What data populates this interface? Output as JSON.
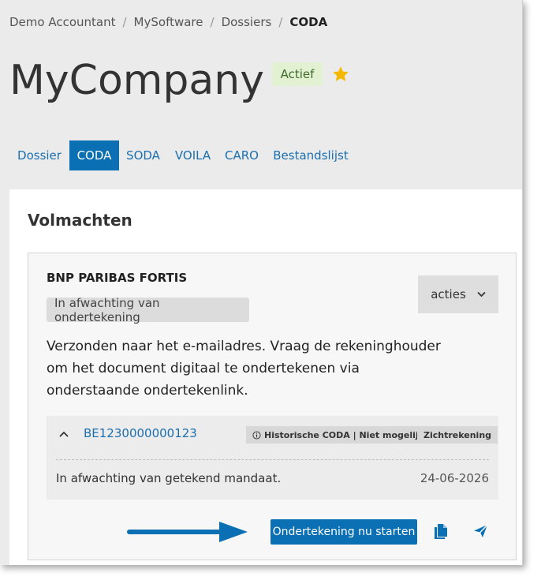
{
  "breadcrumb": {
    "items": [
      "Demo Accountant",
      "MySoftware",
      "Dossiers"
    ],
    "current": "CODA"
  },
  "header": {
    "title": "MyCompany",
    "status": "Actief"
  },
  "tabs": [
    {
      "label": "Dossier"
    },
    {
      "label": "CODA",
      "active": true
    },
    {
      "label": "SODA"
    },
    {
      "label": "VOILA"
    },
    {
      "label": "CARO"
    },
    {
      "label": "Bestandslijst"
    }
  ],
  "section": {
    "title": "Volmachten"
  },
  "card": {
    "bank": "BNP PARIBAS FORTIS",
    "status": "In afwachting van ondertekening",
    "actions_label": "acties",
    "message": "Verzonden naar het e-mailadres. Vraag de rekeninghouder om het document digitaal te ondertekenen via onderstaande ondertekenlink.",
    "account": {
      "iban": "BE1230000000123",
      "tag_history": "Historische CODA | Niet mogelijk",
      "tag_type": "Zichtrekening",
      "pending": "In afwachting van getekend mandaat.",
      "date": "24-06-2026"
    },
    "start_label": "Ondertekening nu starten"
  },
  "colors": {
    "primary": "#0b6fb4",
    "link": "#1a6fb0",
    "star": "#f5b800",
    "active_badge_bg": "#e2f1d2"
  },
  "icons": {
    "favorite": "star-icon",
    "copy": "copy-icon",
    "send": "send-icon",
    "info": "info-icon"
  }
}
